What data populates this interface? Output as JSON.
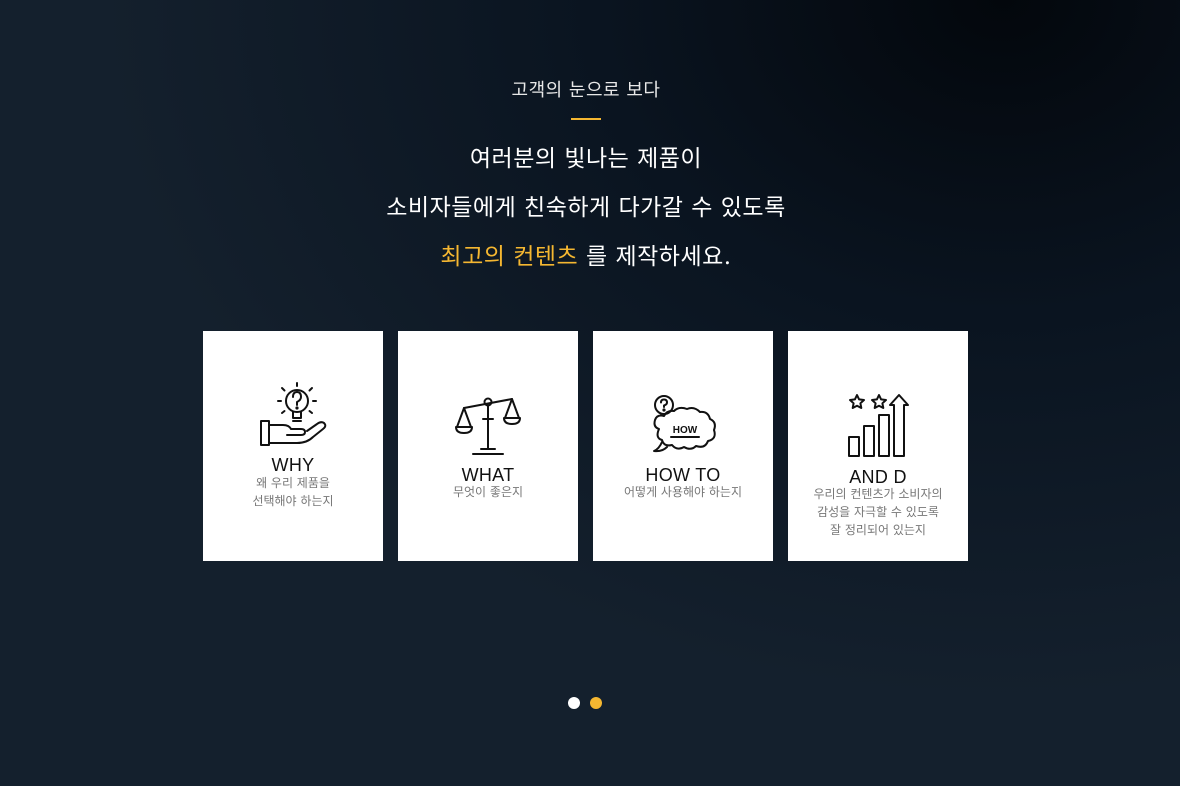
{
  "hero": {
    "eyebrow": "고객의 눈으로 보다",
    "line1": "여러분의 빛나는 제품이",
    "line2": "소비자들에게 친숙하게 다가갈 수 있도록",
    "line3_accent": "최고의 컨텐츠",
    "line3_rest": " 를 제작하세요."
  },
  "cards": [
    {
      "title": "WHY",
      "desc": [
        "왜 우리 제품을",
        "선택해야 하는지"
      ],
      "icon": "lightbulb-hand-icon"
    },
    {
      "title": "WHAT",
      "desc": [
        "무엇이 좋은지"
      ],
      "icon": "balance-scale-icon"
    },
    {
      "title": "HOW TO",
      "desc": [
        "어떻게 사용해야 하는지"
      ],
      "icon": "how-thought-bubble-icon"
    },
    {
      "title": "AND D",
      "desc": [
        "우리의 컨텐츠가 소비자의",
        "감성을 자극할 수 있도록",
        "잘 정리되어 있는지"
      ],
      "icon": "growth-chart-stars-icon"
    }
  ],
  "pagination": {
    "active_index": 1,
    "dots": 2,
    "active_color": "#f5b731",
    "inactive_color": "#ffffff"
  },
  "colors": {
    "accent": "#f5b731",
    "card_bg": "#ffffff"
  }
}
